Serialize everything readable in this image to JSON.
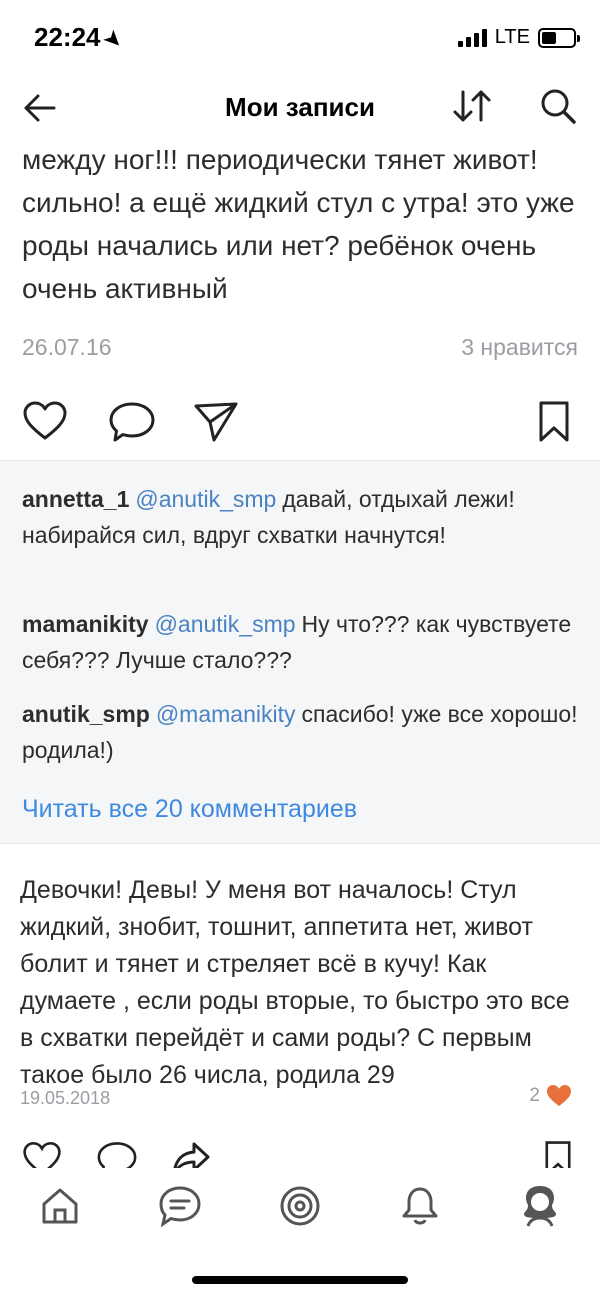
{
  "status_bar": {
    "time": "22:24",
    "network": "LTE",
    "battery_level": 0.45
  },
  "nav": {
    "title": "Мои записи",
    "icons": [
      "back-arrow-icon",
      "sort-icon",
      "search-icon"
    ]
  },
  "post1": {
    "text": "между ног!!! периодически тянет живот! сильно! а ещё жидкий стул с утра! это уже роды начались или нет? ребёнок очень очень активный",
    "date": "26.07.16",
    "likes_text": "3 нравится",
    "actions": [
      "heart-icon",
      "comment-icon",
      "share-icon",
      "bookmark-icon"
    ]
  },
  "comments": {
    "items": [
      {
        "author": "annetta_1",
        "mention": "@anutik_smp",
        "text": "давай, отдыхай лежи! набирайся сил, вдруг схватки начнутся!"
      },
      {
        "author": "mamanikity",
        "mention": "@anutik_smp",
        "text": "Ну что??? как чувствуете себя??? Лучше стало???"
      },
      {
        "author": "anutik_smp",
        "mention": "@mamanikity",
        "text": "спасибо! уже все хорошо! родила!)"
      }
    ],
    "read_all": "Читать все 20 комментариев"
  },
  "post2": {
    "text": "Девочки! Девы! У меня вот началось! Стул жидкий, знобит, тошнит, аппетита нет, живот болит и тянет и стреляет всё в кучу! Как думаете , если роды вторые, то быстро это все в схватки перейдёт и сами роды? С первым такое было 26 числа, родила 29",
    "date": "19.05.2018",
    "likes": "2",
    "like_color": "#e8703a"
  },
  "tab_bar": {
    "tabs": [
      "home-icon",
      "messages-icon",
      "discover-icon",
      "notifications-icon",
      "profile-icon"
    ]
  },
  "colors": {
    "accent": "#3f8ae0",
    "mention": "#4a82c2",
    "muted": "#9a9ea3",
    "comments_bg": "#f5f6f7"
  }
}
